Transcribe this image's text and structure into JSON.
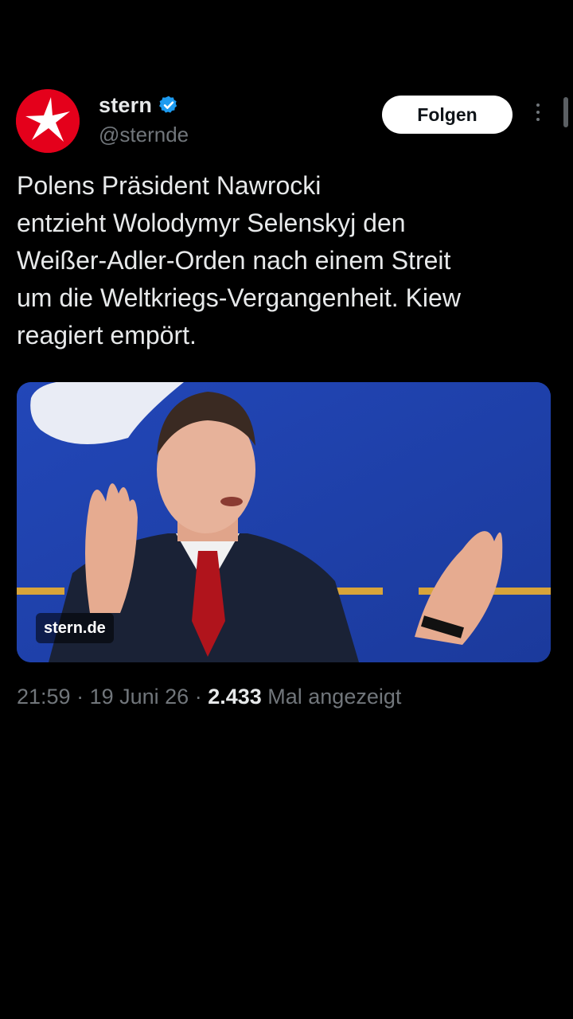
{
  "author": {
    "display_name": "stern",
    "handle": "@sternde",
    "verified": true,
    "avatar_color": "#e4001b"
  },
  "actions": {
    "follow_label": "Folgen",
    "more_icon": "more-vertical-icon"
  },
  "tweet": {
    "text": "Polens Präsident Nawrocki\nentzieht Wolodymyr Selenskyj den\nWeißer-Adler-Orden nach einem Streit\num die Weltkriegs-Vergangenheit. Kiew\nreagiert empört."
  },
  "media": {
    "badge": "stern.de",
    "background_color": "#1d3fa8"
  },
  "meta": {
    "time": "21:59",
    "separator_1": " · ",
    "date": "19 Juni 26",
    "separator_2": " · ",
    "views": "2.433",
    "views_label": " Mal angezeigt"
  },
  "colors": {
    "background": "#000000",
    "text": "#e7e9ea",
    "secondary_text": "#71767b",
    "verified_badge": "#1d9bf0"
  }
}
